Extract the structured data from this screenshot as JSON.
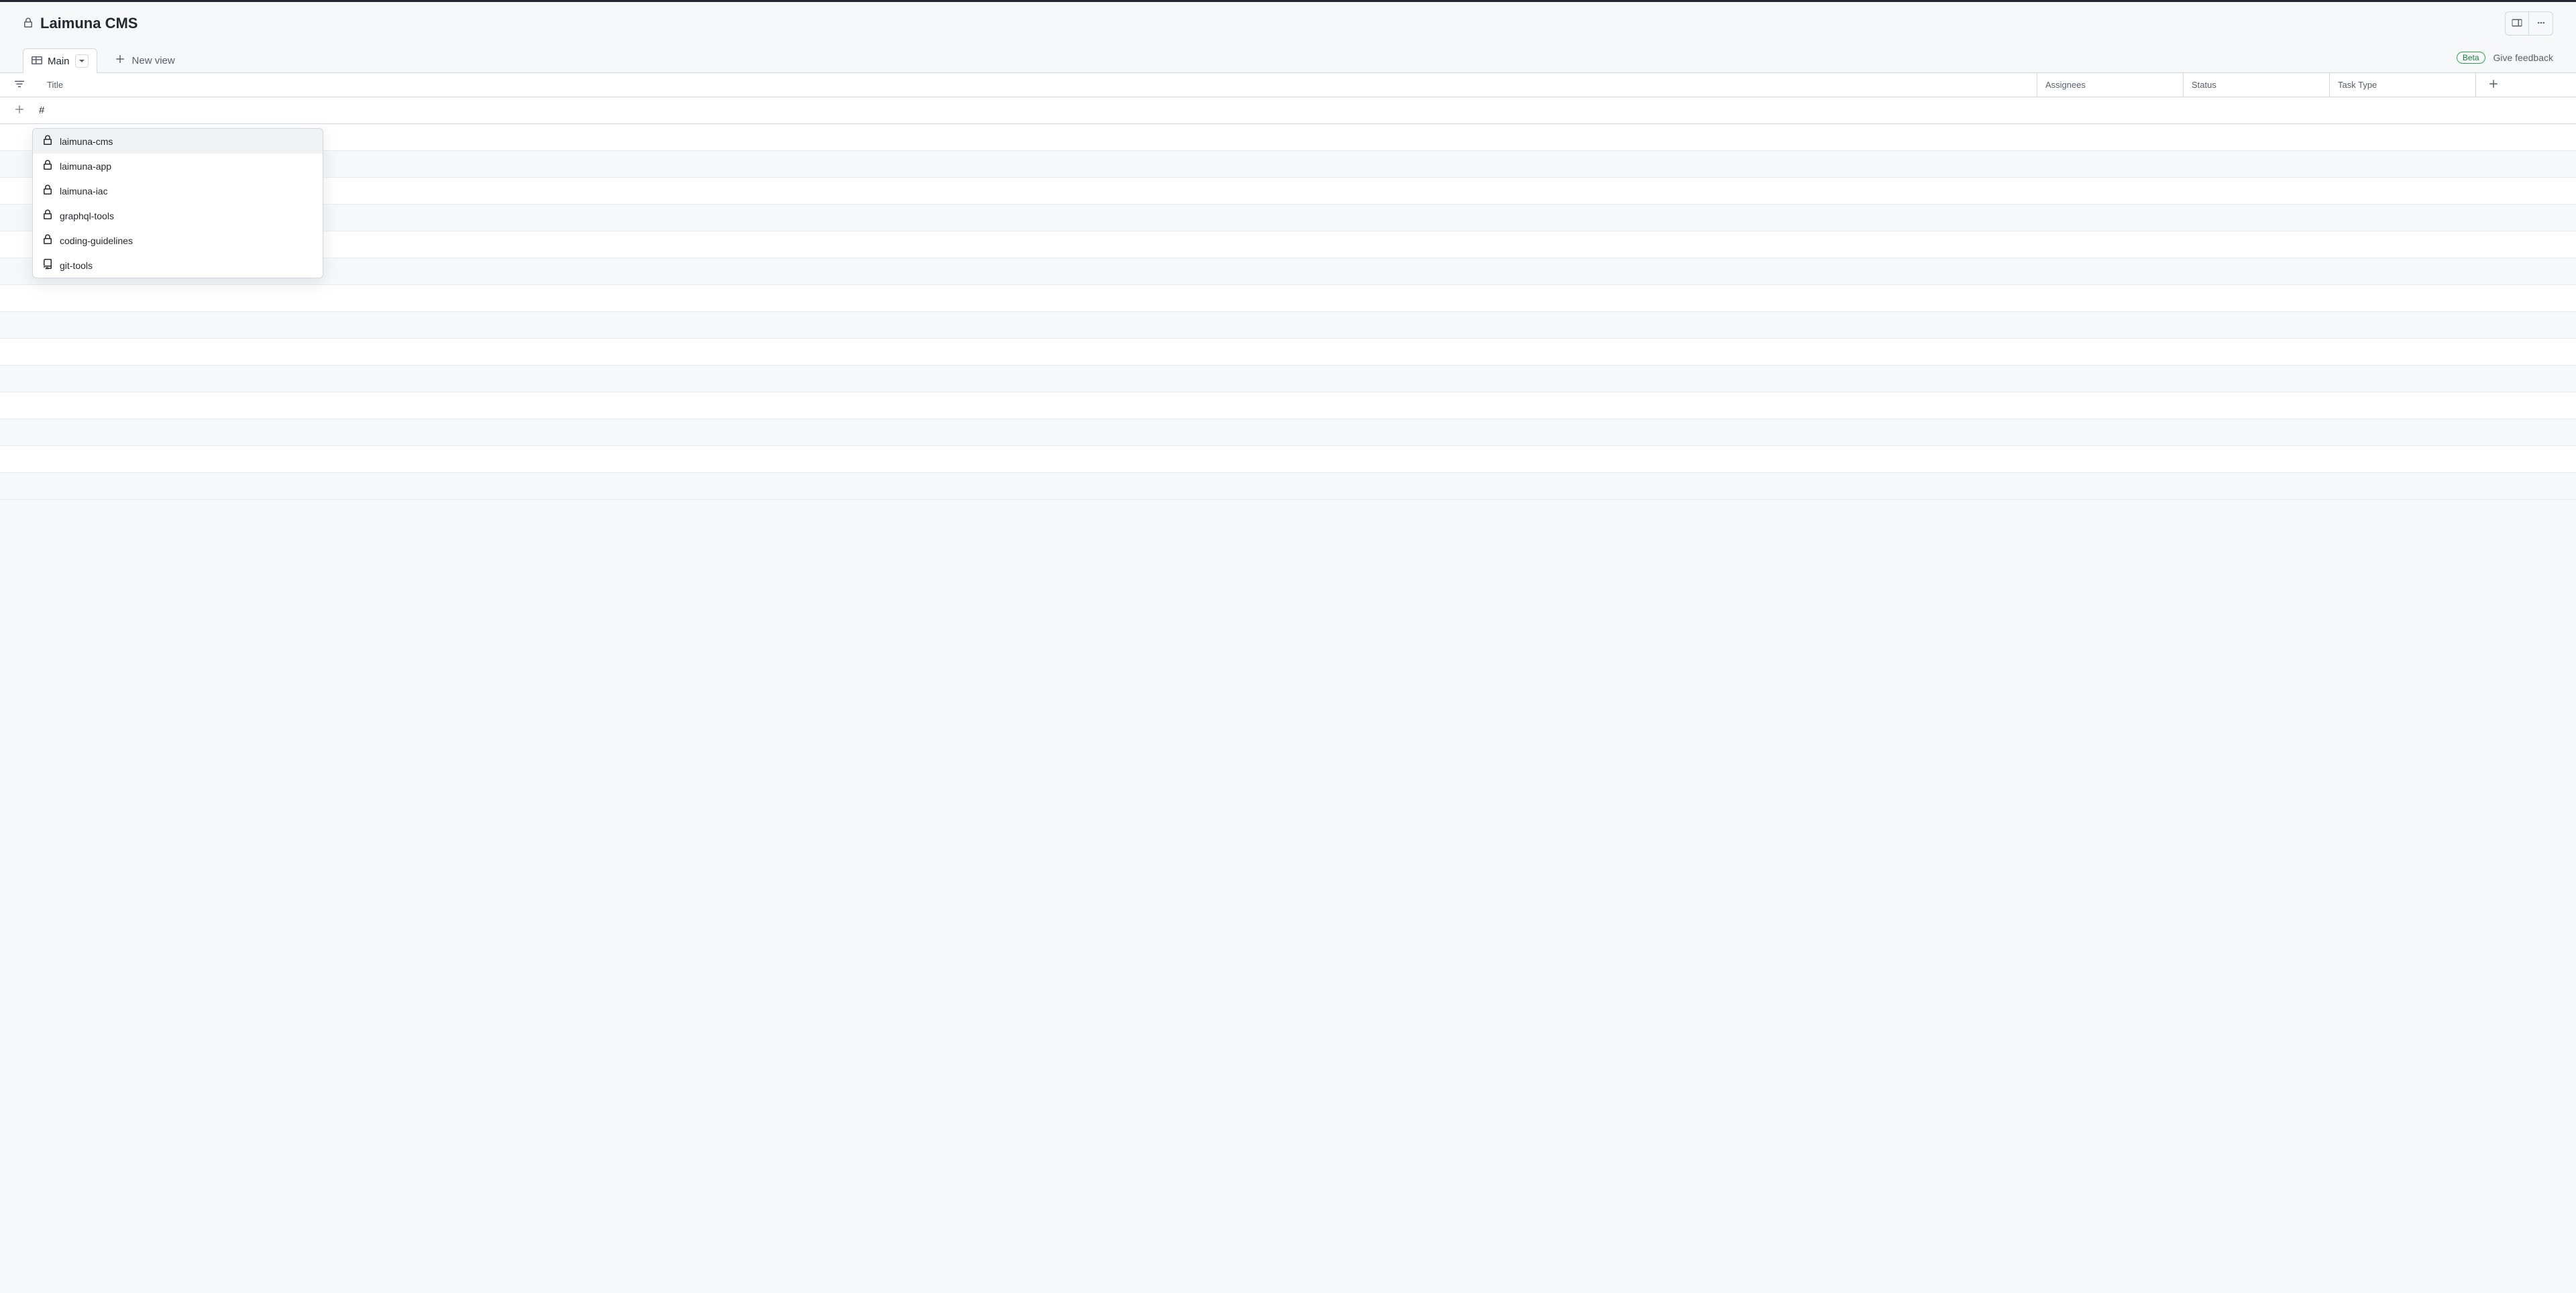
{
  "header": {
    "title": "Laimuna CMS"
  },
  "tabs": {
    "active_label": "Main",
    "new_view_label": "New view"
  },
  "meta": {
    "beta_label": "Beta",
    "feedback_label": "Give feedback"
  },
  "columns": {
    "title": "Title",
    "assignees": "Assignees",
    "status": "Status",
    "task_type": "Task Type"
  },
  "input": {
    "value": "#"
  },
  "dropdown": {
    "items": [
      {
        "icon": "lock",
        "label": "laimuna-cms",
        "selected": true
      },
      {
        "icon": "lock",
        "label": "laimuna-app",
        "selected": false
      },
      {
        "icon": "lock",
        "label": "laimuna-iac",
        "selected": false
      },
      {
        "icon": "lock",
        "label": "graphql-tools",
        "selected": false
      },
      {
        "icon": "lock",
        "label": "coding-guidelines",
        "selected": false
      },
      {
        "icon": "repo",
        "label": "git-tools",
        "selected": false
      }
    ]
  }
}
